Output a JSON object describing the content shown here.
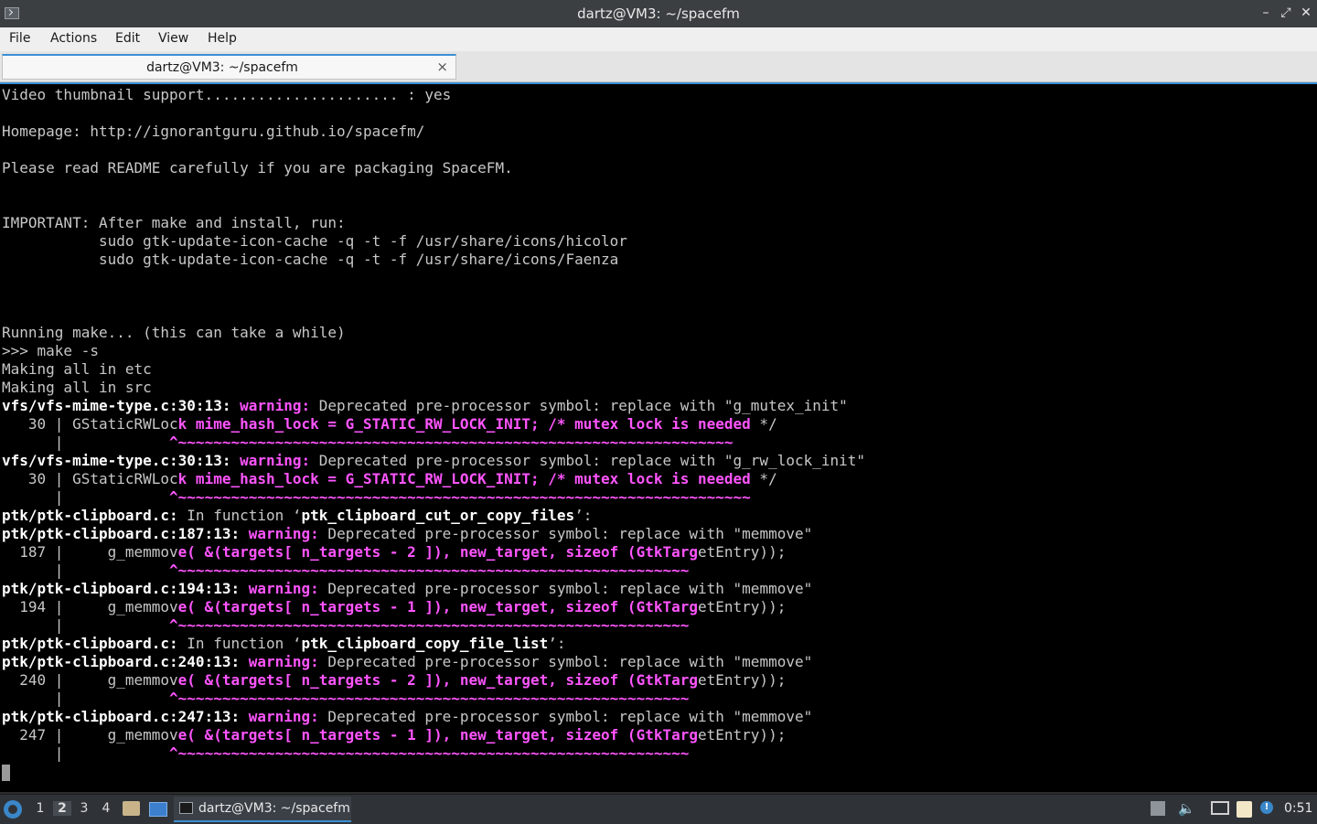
{
  "window": {
    "title": "dartz@VM3: ~/spacefm"
  },
  "menu": {
    "file": "File",
    "actions": "Actions",
    "edit": "Edit",
    "view": "View",
    "help": "Help"
  },
  "tab": {
    "label": "dartz@VM3: ~/spacefm",
    "close": "×"
  },
  "terminal": {
    "lines": [
      [
        {
          "t": "Video thumbnail support...................... : yes",
          "s": ""
        }
      ],
      [
        {
          "t": "",
          "s": ""
        }
      ],
      [
        {
          "t": "Homepage: http://ignorantguru.github.io/spacefm/",
          "s": ""
        }
      ],
      [
        {
          "t": "",
          "s": ""
        }
      ],
      [
        {
          "t": "Please read README carefully if you are packaging SpaceFM.",
          "s": ""
        }
      ],
      [
        {
          "t": "",
          "s": ""
        }
      ],
      [
        {
          "t": "",
          "s": ""
        }
      ],
      [
        {
          "t": "IMPORTANT: After make and install, run:",
          "s": ""
        }
      ],
      [
        {
          "t": "           sudo gtk-update-icon-cache -q -t -f /usr/share/icons/hicolor",
          "s": ""
        }
      ],
      [
        {
          "t": "           sudo gtk-update-icon-cache -q -t -f /usr/share/icons/Faenza",
          "s": ""
        }
      ],
      [
        {
          "t": "",
          "s": ""
        }
      ],
      [
        {
          "t": "",
          "s": ""
        }
      ],
      [
        {
          "t": "",
          "s": ""
        }
      ],
      [
        {
          "t": "Running make... (this can take a while)",
          "s": ""
        }
      ],
      [
        {
          "t": ">>> make -s",
          "s": ""
        }
      ],
      [
        {
          "t": "Making all in etc",
          "s": ""
        }
      ],
      [
        {
          "t": "Making all in src",
          "s": ""
        }
      ],
      [
        {
          "t": "vfs/vfs-mime-type.c:30:13:",
          "s": "b"
        },
        {
          "t": " ",
          "s": ""
        },
        {
          "t": "warning:",
          "s": "w"
        },
        {
          "t": " Deprecated pre-processor symbol: replace with \"g_mutex_init\"",
          "s": ""
        }
      ],
      [
        {
          "t": "   30 | GStaticRWLoc",
          "s": ""
        },
        {
          "t": "k mime_hash_lock = G_STATIC_RW_LOCK_INIT; /* mutex lock is needed",
          "s": "w"
        },
        {
          "t": " */",
          "s": ""
        }
      ],
      [
        {
          "t": "      |            ",
          "s": ""
        },
        {
          "t": "^~~~~~~~~~~~~~~~~~~~~~~~~~~~~~~~~~~~~~~~~~~~~~~~~~~~~~~~~~~~~~~~",
          "s": "w"
        }
      ],
      [
        {
          "t": "vfs/vfs-mime-type.c:30:13:",
          "s": "b"
        },
        {
          "t": " ",
          "s": ""
        },
        {
          "t": "warning:",
          "s": "w"
        },
        {
          "t": " Deprecated pre-processor symbol: replace with \"g_rw_lock_init\"",
          "s": ""
        }
      ],
      [
        {
          "t": "   30 | GStaticRWLoc",
          "s": ""
        },
        {
          "t": "k mime_hash_lock = G_STATIC_RW_LOCK_INIT; /* mutex lock is needed",
          "s": "w"
        },
        {
          "t": " */",
          "s": ""
        }
      ],
      [
        {
          "t": "      |            ",
          "s": ""
        },
        {
          "t": "^~~~~~~~~~~~~~~~~~~~~~~~~~~~~~~~~~~~~~~~~~~~~~~~~~~~~~~~~~~~~~~~~~",
          "s": "w"
        }
      ],
      [
        {
          "t": "ptk/ptk-clipboard.c:",
          "s": "b"
        },
        {
          "t": " In function ‘",
          "s": ""
        },
        {
          "t": "ptk_clipboard_cut_or_copy_files",
          "s": "b"
        },
        {
          "t": "’:",
          "s": ""
        }
      ],
      [
        {
          "t": "ptk/ptk-clipboard.c:187:13:",
          "s": "b"
        },
        {
          "t": " ",
          "s": ""
        },
        {
          "t": "warning:",
          "s": "w"
        },
        {
          "t": " Deprecated pre-processor symbol: replace with \"memmove\"",
          "s": ""
        }
      ],
      [
        {
          "t": "  187 |     g_memmov",
          "s": ""
        },
        {
          "t": "e( &(targets[ n_targets - 2 ]), new_target, sizeof (GtkTarg",
          "s": "w"
        },
        {
          "t": "etEntry));",
          "s": ""
        }
      ],
      [
        {
          "t": "      |            ",
          "s": ""
        },
        {
          "t": "^~~~~~~~~~~~~~~~~~~~~~~~~~~~~~~~~~~~~~~~~~~~~~~~~~~~~~~~~~~",
          "s": "w"
        }
      ],
      [
        {
          "t": "ptk/ptk-clipboard.c:194:13:",
          "s": "b"
        },
        {
          "t": " ",
          "s": ""
        },
        {
          "t": "warning:",
          "s": "w"
        },
        {
          "t": " Deprecated pre-processor symbol: replace with \"memmove\"",
          "s": ""
        }
      ],
      [
        {
          "t": "  194 |     g_memmov",
          "s": ""
        },
        {
          "t": "e( &(targets[ n_targets - 1 ]), new_target, sizeof (GtkTarg",
          "s": "w"
        },
        {
          "t": "etEntry));",
          "s": ""
        }
      ],
      [
        {
          "t": "      |            ",
          "s": ""
        },
        {
          "t": "^~~~~~~~~~~~~~~~~~~~~~~~~~~~~~~~~~~~~~~~~~~~~~~~~~~~~~~~~~~",
          "s": "w"
        }
      ],
      [
        {
          "t": "ptk/ptk-clipboard.c:",
          "s": "b"
        },
        {
          "t": " In function ‘",
          "s": ""
        },
        {
          "t": "ptk_clipboard_copy_file_list",
          "s": "b"
        },
        {
          "t": "’:",
          "s": ""
        }
      ],
      [
        {
          "t": "ptk/ptk-clipboard.c:240:13:",
          "s": "b"
        },
        {
          "t": " ",
          "s": ""
        },
        {
          "t": "warning:",
          "s": "w"
        },
        {
          "t": " Deprecated pre-processor symbol: replace with \"memmove\"",
          "s": ""
        }
      ],
      [
        {
          "t": "  240 |     g_memmov",
          "s": ""
        },
        {
          "t": "e( &(targets[ n_targets - 2 ]), new_target, sizeof (GtkTarg",
          "s": "w"
        },
        {
          "t": "etEntry));",
          "s": ""
        }
      ],
      [
        {
          "t": "      |            ",
          "s": ""
        },
        {
          "t": "^~~~~~~~~~~~~~~~~~~~~~~~~~~~~~~~~~~~~~~~~~~~~~~~~~~~~~~~~~~",
          "s": "w"
        }
      ],
      [
        {
          "t": "ptk/ptk-clipboard.c:247:13:",
          "s": "b"
        },
        {
          "t": " ",
          "s": ""
        },
        {
          "t": "warning:",
          "s": "w"
        },
        {
          "t": " Deprecated pre-processor symbol: replace with \"memmove\"",
          "s": ""
        }
      ],
      [
        {
          "t": "  247 |     g_memmov",
          "s": ""
        },
        {
          "t": "e( &(targets[ n_targets - 1 ]), new_target, sizeof (GtkTarg",
          "s": "w"
        },
        {
          "t": "etEntry));",
          "s": ""
        }
      ],
      [
        {
          "t": "      |            ",
          "s": ""
        },
        {
          "t": "^~~~~~~~~~~~~~~~~~~~~~~~~~~~~~~~~~~~~~~~~~~~~~~~~~~~~~~~~~~",
          "s": "w"
        }
      ]
    ]
  },
  "taskbar": {
    "workspaces": [
      "1",
      "2",
      "3",
      "4"
    ],
    "task_label": "dartz@VM3: ~/spacefm",
    "clock": "0:51",
    "notify_badge": "!"
  },
  "colors": {
    "terminal_bg": "#000000",
    "terminal_fg": "#c7c7c7",
    "warning": "#ff55ff",
    "accent": "#3b8fd4"
  }
}
